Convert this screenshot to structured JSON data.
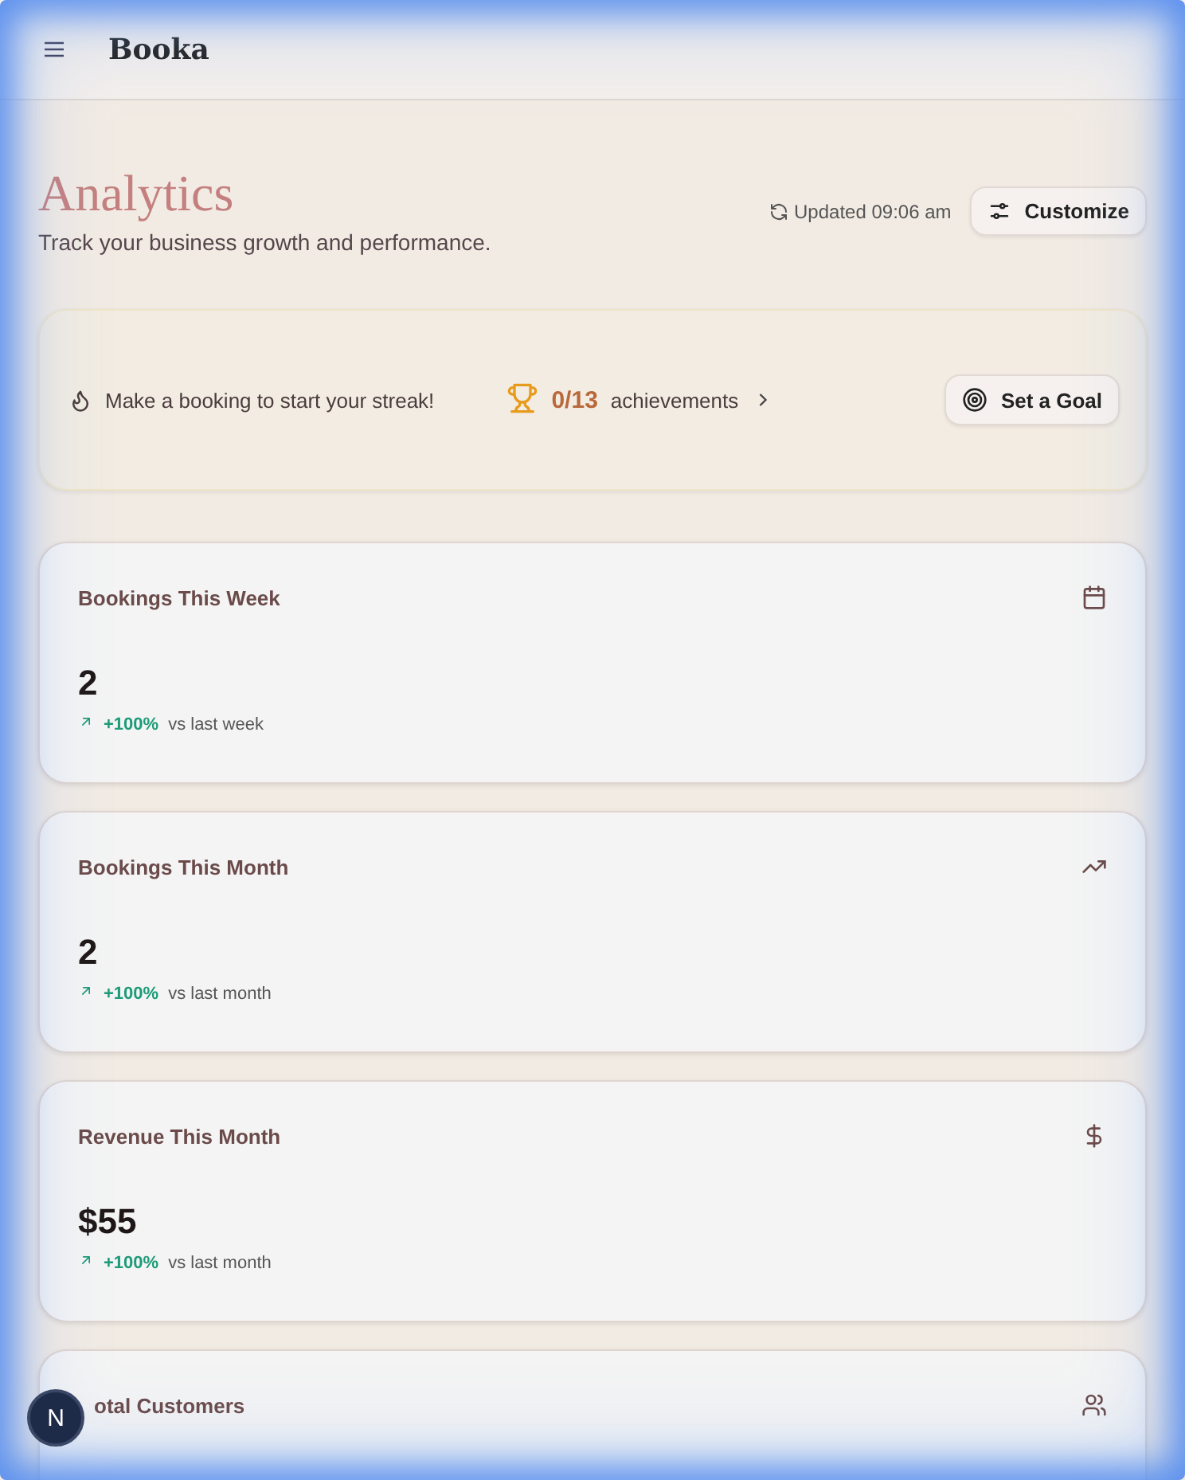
{
  "header": {
    "title": "Booka"
  },
  "page": {
    "title": "Analytics",
    "subtitle": "Track your business growth and performance.",
    "updated": "Updated 09:06 am",
    "customize_button": "Customize"
  },
  "streak": {
    "message": "Make a booking to start your streak!",
    "achievements_count": "0/13",
    "achievements_label": "achievements",
    "goal_button": "Set a Goal"
  },
  "stats": [
    {
      "title": "Bookings This Week",
      "value": "2",
      "change": "+100%",
      "comparison": "vs last week"
    },
    {
      "title": "Bookings This Month",
      "value": "2",
      "change": "+100%",
      "comparison": "vs last month"
    },
    {
      "title": "Revenue This Month",
      "value": "$55",
      "change": "+100%",
      "comparison": "vs last month"
    },
    {
      "title": "otal Customers"
    }
  ],
  "avatar": {
    "initial": "N"
  }
}
